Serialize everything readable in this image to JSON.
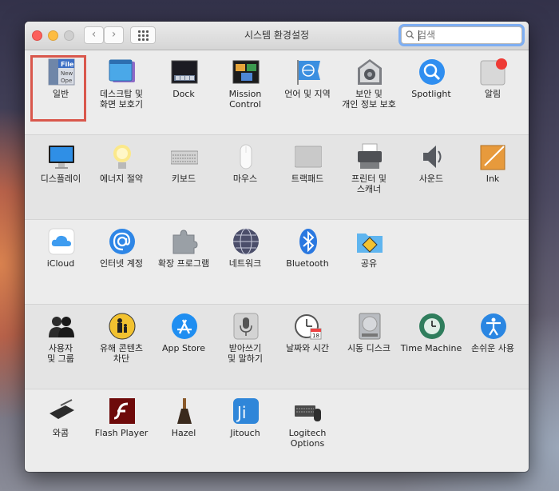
{
  "window": {
    "title": "시스템 환경설정"
  },
  "toolbar": {
    "back": "‹",
    "forward": "›"
  },
  "search": {
    "value": "",
    "placeholder": "검색"
  },
  "sections": [
    {
      "items": [
        {
          "label": "일반",
          "icon": "general-icon"
        },
        {
          "label": "데스크탑 및\n화면 보호기",
          "icon": "desktop-icon"
        },
        {
          "label": "Dock",
          "icon": "dock-icon"
        },
        {
          "label": "Mission\nControl",
          "icon": "mission-control-icon"
        },
        {
          "label": "언어 및 지역",
          "icon": "language-icon"
        },
        {
          "label": "보안 및\n개인 정보 보호",
          "icon": "security-icon"
        },
        {
          "label": "Spotlight",
          "icon": "spotlight-icon"
        },
        {
          "label": "알림",
          "icon": "notifications-icon"
        }
      ]
    },
    {
      "items": [
        {
          "label": "디스플레이",
          "icon": "display-icon"
        },
        {
          "label": "에너지 절약",
          "icon": "energy-icon"
        },
        {
          "label": "키보드",
          "icon": "keyboard-icon"
        },
        {
          "label": "마우스",
          "icon": "mouse-icon"
        },
        {
          "label": "트랙패드",
          "icon": "trackpad-icon"
        },
        {
          "label": "프린터 및\n스캐너",
          "icon": "printer-icon"
        },
        {
          "label": "사운드",
          "icon": "sound-icon"
        },
        {
          "label": "Ink",
          "icon": "ink-icon"
        }
      ]
    },
    {
      "items": [
        {
          "label": "iCloud",
          "icon": "icloud-icon"
        },
        {
          "label": "인터넷 계정",
          "icon": "internet-accounts-icon"
        },
        {
          "label": "확장 프로그램",
          "icon": "extensions-icon"
        },
        {
          "label": "네트워크",
          "icon": "network-icon"
        },
        {
          "label": "Bluetooth",
          "icon": "bluetooth-icon"
        },
        {
          "label": "공유",
          "icon": "sharing-icon"
        }
      ]
    },
    {
      "items": [
        {
          "label": "사용자\n및 그룹",
          "icon": "users-icon"
        },
        {
          "label": "유해 콘텐츠\n차단",
          "icon": "parental-controls-icon"
        },
        {
          "label": "App Store",
          "icon": "app-store-icon"
        },
        {
          "label": "받아쓰기\n및 말하기",
          "icon": "dictation-icon"
        },
        {
          "label": "날짜와 시간",
          "icon": "date-time-icon"
        },
        {
          "label": "시동 디스크",
          "icon": "startup-disk-icon"
        },
        {
          "label": "Time Machine",
          "icon": "time-machine-icon"
        },
        {
          "label": "손쉬운 사용",
          "icon": "accessibility-icon"
        }
      ]
    },
    {
      "items": [
        {
          "label": "와콤",
          "icon": "wacom-icon"
        },
        {
          "label": "Flash Player",
          "icon": "flash-icon"
        },
        {
          "label": "Hazel",
          "icon": "hazel-icon"
        },
        {
          "label": "Jitouch",
          "icon": "jitouch-icon"
        },
        {
          "label": "Logitech Options",
          "icon": "logitech-icon"
        }
      ]
    }
  ],
  "icon_text": {
    "general": [
      "File",
      "New",
      "Ope"
    ],
    "calendar_day": "18",
    "jitouch": "Ji"
  },
  "colors": {
    "highlight": "#d9574c",
    "search_focus": "#7eaef2"
  }
}
